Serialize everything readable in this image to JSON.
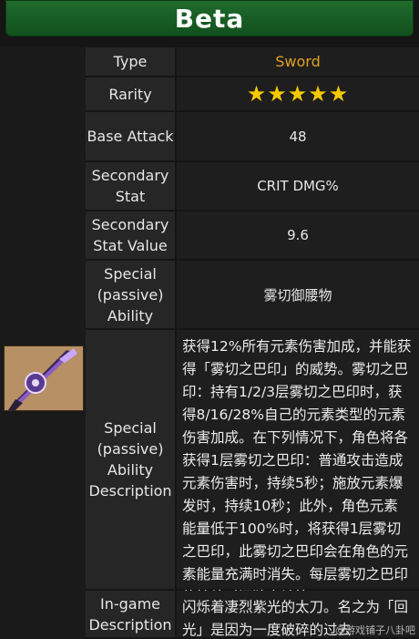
{
  "title": "Beta",
  "rows": {
    "type": {
      "label": "Type",
      "value": "Sword"
    },
    "rarity": {
      "label": "Rarity",
      "value": "★★★★★"
    },
    "base_attack": {
      "label": "Base Attack",
      "value": "48"
    },
    "secondary_stat": {
      "label": "Secondary Stat",
      "value": "CRIT DMG%"
    },
    "secondary_stat_value": {
      "label": "Secondary Stat Value",
      "value": "9.6"
    },
    "special_ability": {
      "label": "Special (passive) Ability",
      "value": "雾切御腰物"
    },
    "special_ability_description": {
      "label": "Special (passive) Ability Description",
      "value": "获得12%所有元素伤害加成，并能获得「雾切之巴印」的威势。雾切之巴印：持有1/2/3层雾切之巴印时，获得8/16/28%自己的元素类型的元素伤害加成。在下列情况下，角色将各获得1层雾切之巴印：普通攻击造成元素伤害时，持续5秒；施放元素爆发时，持续10秒；此外，角色元素能量低于100%时，将获得1层雾切之巴印，此雾切之巴印会在角色的元素能量充满时消失。每层雾切之巴印的持续时间独立计算。"
    },
    "in_game_description": {
      "label": "In-game Description",
      "value": "闪烁着凄烈紫光的太刀。名之为「回光」是因为一度破碎的过去"
    }
  },
  "watermark": "@游戏铺子八卦吧",
  "colors": {
    "title_bar": "#1f6b2c",
    "type_value": "#e0a020",
    "stars": "#f5c800"
  }
}
